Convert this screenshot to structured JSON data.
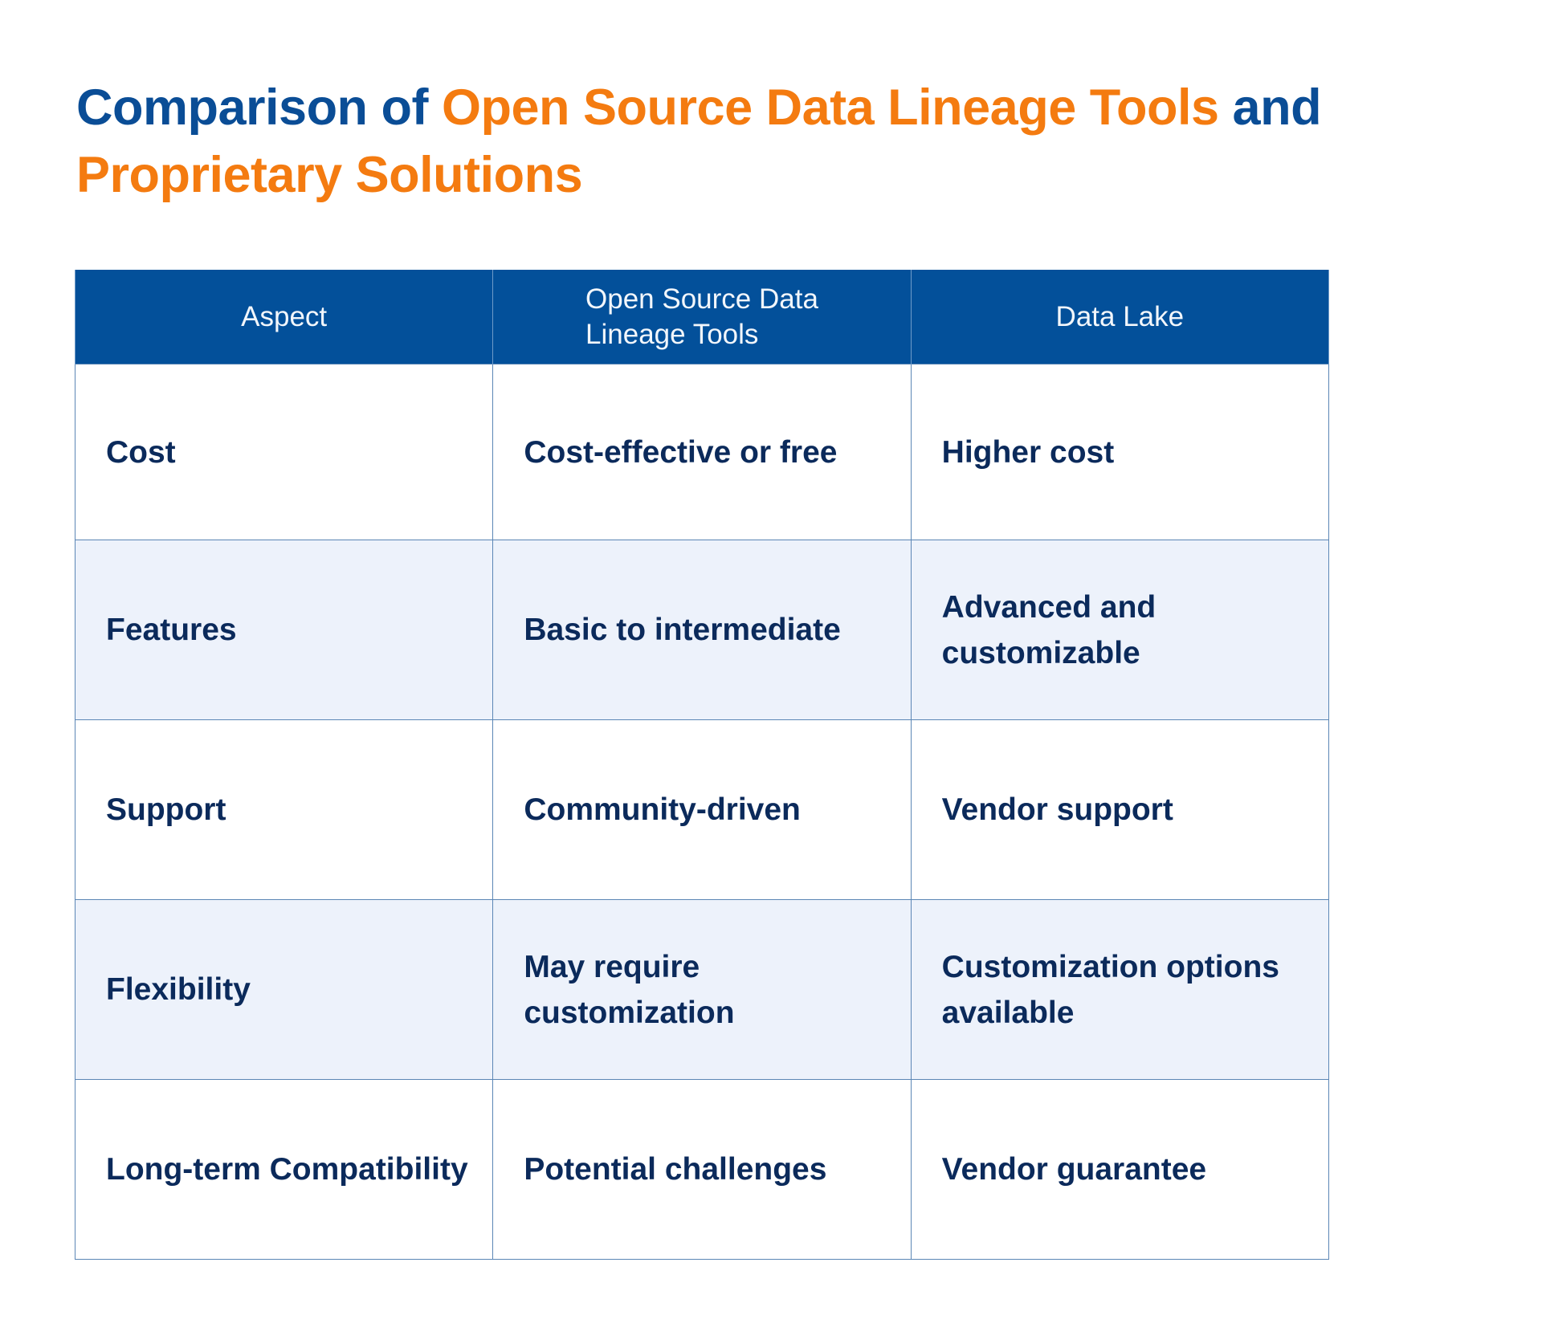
{
  "title": {
    "part1": "Comparison of ",
    "part2": "Open Source Data Lineage Tools",
    "part3": " and ",
    "part4": "Proprietary Solutions"
  },
  "colors": {
    "title_primary": "#0a4d96",
    "title_accent": "#f47b10",
    "header_bg": "#03509a",
    "header_text": "#f2f6fb",
    "cell_text": "#0b2a5b",
    "alt_row_bg": "#edf2fb",
    "border": "#5b86b5"
  },
  "table": {
    "headers": [
      "Aspect",
      "Open Source Data Lineage Tools",
      "Data Lake"
    ],
    "headers_lines": {
      "col2_line1": "Open Source Data",
      "col2_line2": "Lineage Tools"
    },
    "rows": [
      [
        "Cost",
        "Cost-effective or free",
        "Higher cost"
      ],
      [
        "Features",
        "Basic to intermediate",
        "Advanced and customizable"
      ],
      [
        "Support",
        "Community-driven",
        "Vendor support"
      ],
      [
        "Flexibility",
        "May require customization",
        "Customization options available"
      ],
      [
        "Long-term Compatibility",
        "Potential challenges",
        "Vendor guarantee"
      ]
    ]
  }
}
